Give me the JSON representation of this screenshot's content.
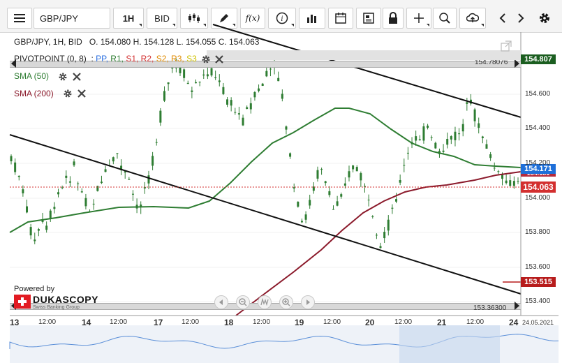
{
  "toolbar": {
    "symbol": "GBP/JPY",
    "timeframe": "1H",
    "price_type": "BID",
    "fx_label": "f(x)"
  },
  "header": {
    "instrument": "GBP/JPY, 1H, BID",
    "o": "O. 154.080",
    "h": "H. 154.128",
    "l": "L. 154.055",
    "c": "C. 154.063"
  },
  "indicators": {
    "pivot_name": "PIVOTPOINT (0, 8)",
    "pivot_sep": ":",
    "pivot_levels": [
      {
        "label": "PP,",
        "color": "#2a6fe0"
      },
      {
        "label": "R1,",
        "color": "#2e7d32"
      },
      {
        "label": "S1,",
        "color": "#d32f2f"
      },
      {
        "label": "R2,",
        "color": "#d32f2f"
      },
      {
        "label": "S2,",
        "color": "#e08a00"
      },
      {
        "label": "R3,",
        "color": "#e08a00"
      },
      {
        "label": "S3",
        "color": "#cfc000"
      }
    ],
    "sma50": "SMA (50)",
    "sma200": "SMA (200)"
  },
  "levels": {
    "top_line": "154.78076",
    "bottom_line": "153.36300"
  },
  "price_boxes": {
    "top": "154.807",
    "sma": "154.171",
    "sma_behind": "154.181",
    "current": "154.063",
    "low": "153.515"
  },
  "y_axis": [
    "154.600",
    "154.400",
    "154.200",
    "154.000",
    "153.800",
    "153.600",
    "153.400"
  ],
  "x_axis": [
    {
      "label": "13",
      "bold": true
    },
    {
      "label": "12:00",
      "bold": false
    },
    {
      "label": "14",
      "bold": true
    },
    {
      "label": "12:00",
      "bold": false
    },
    {
      "label": "17",
      "bold": true
    },
    {
      "label": "12:00",
      "bold": false
    },
    {
      "label": "18",
      "bold": true
    },
    {
      "label": "12:00",
      "bold": false
    },
    {
      "label": "19",
      "bold": true
    },
    {
      "label": "12:00",
      "bold": false
    },
    {
      "label": "20",
      "bold": true
    },
    {
      "label": "12:00",
      "bold": false
    },
    {
      "label": "21",
      "bold": true
    },
    {
      "label": "12:00",
      "bold": false
    },
    {
      "label": "24",
      "bold": true
    },
    {
      "label": "24.05.2021",
      "bold": false
    }
  ],
  "branding": {
    "powered_by": "Powered by",
    "name": "DUKASCOPY",
    "tagline": "Swiss Banking Group"
  },
  "colors": {
    "sma50": "#2e7d32",
    "sma200": "#8b1a2b",
    "sma_box": "#1e6fd9",
    "current_box": "#d32f2f",
    "top_box": "#1b5e20",
    "low_box": "#b71c1c",
    "candles": "#2e7d32"
  }
}
